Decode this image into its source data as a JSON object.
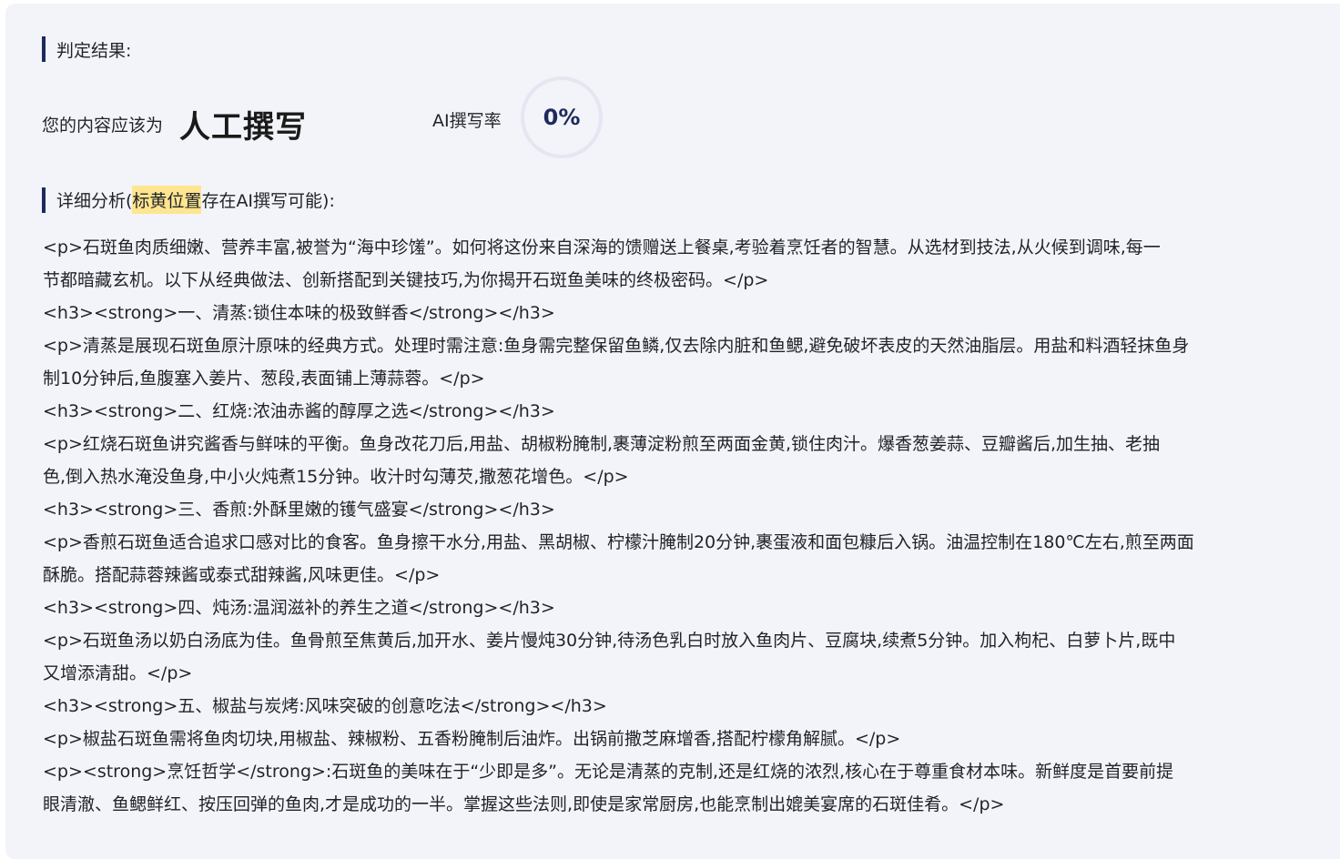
{
  "result": {
    "section_title": "判定结果:",
    "verdict_label": "您的内容应该为",
    "verdict_value": "人工撰写",
    "rate_label": "AI撰写率",
    "rate_value": "0%"
  },
  "analysis": {
    "title_prefix": "详细分析(",
    "title_highlight": "标黄位置",
    "title_suffix": "存在AI撰写可能):",
    "lines": [
      "<p>石斑鱼肉质细嫩、营养丰富,被誉为“海中珍馐”。如何将这份来自深海的馈赠送上餐桌,考验着烹饪者的智慧。从选材到技法,从火候到调味,每一",
      "节都暗藏玄机。以下从经典做法、创新搭配到关键技巧,为你揭开石斑鱼美味的终极密码。</p>",
      "<h3><strong>一、清蒸:锁住本味的极致鲜香</strong></h3>",
      "<p>清蒸是展现石斑鱼原汁原味的经典方式。处理时需注意:鱼身需完整保留鱼鳞,仅去除内脏和鱼鳃,避免破坏表皮的天然油脂层。用盐和料酒轻抹鱼身",
      "制10分钟后,鱼腹塞入姜片、葱段,表面铺上薄蒜蓉。</p>",
      "<h3><strong>二、红烧:浓油赤酱的醇厚之选</strong></h3>",
      "<p>红烧石斑鱼讲究酱香与鲜味的平衡。鱼身改花刀后,用盐、胡椒粉腌制,裹薄淀粉煎至两面金黄,锁住肉汁。爆香葱姜蒜、豆瓣酱后,加生抽、老抽",
      "色,倒入热水淹没鱼身,中小火炖煮15分钟。收汁时勾薄芡,撒葱花增色。</p>",
      "<h3><strong>三、香煎:外酥里嫩的镬气盛宴</strong></h3>",
      "<p>香煎石斑鱼适合追求口感对比的食客。鱼身擦干水分,用盐、黑胡椒、柠檬汁腌制20分钟,裹蛋液和面包糠后入锅。油温控制在180℃左右,煎至两面",
      "酥脆。搭配蒜蓉辣酱或泰式甜辣酱,风味更佳。</p>",
      "<h3><strong>四、炖汤:温润滋补的养生之道</strong></h3>",
      "<p>石斑鱼汤以奶白汤底为佳。鱼骨煎至焦黄后,加开水、姜片慢炖30分钟,待汤色乳白时放入鱼肉片、豆腐块,续煮5分钟。加入枸杞、白萝卜片,既中",
      "又增添清甜。</p>",
      "<h3><strong>五、椒盐与炭烤:风味突破的创意吃法</strong></h3>",
      "<p>椒盐石斑鱼需将鱼肉切块,用椒盐、辣椒粉、五香粉腌制后油炸。出锅前撒芝麻增香,搭配柠檬角解腻。</p>",
      "<p><strong>烹饪哲学</strong>:石斑鱼的美味在于“少即是多”。无论是清蒸的克制,还是红烧的浓烈,核心在于尊重食材本味。新鲜度是首要前提",
      "眼清澈、鱼鳃鲜红、按压回弹的鱼肉,才是成功的一半。掌握这些法则,即使是家常厨房,也能烹制出媲美宴席的石斑佳肴。</p>"
    ]
  }
}
